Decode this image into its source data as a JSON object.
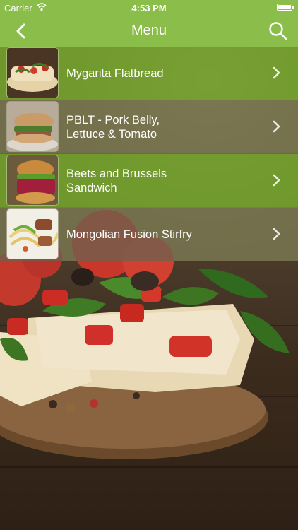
{
  "status_bar": {
    "carrier": "Carrier",
    "time": "4:53 PM"
  },
  "nav": {
    "title": "Menu",
    "back_icon": "chevron-left-icon",
    "search_icon": "search-icon"
  },
  "menu_items": [
    {
      "label": "Mygarita Flatbread",
      "thumbnail": "flatbread-photo"
    },
    {
      "label": "PBLT - Pork Belly,\nLettuce & Tomato",
      "thumbnail": "pblt-photo"
    },
    {
      "label": "Beets and Brussels\nSandwich",
      "thumbnail": "beet-sandwich-photo"
    },
    {
      "label": "Mongolian Fusion Stirfry",
      "thumbnail": "stirfry-photo"
    }
  ],
  "colors": {
    "bar_green": "#8bbd4a",
    "row_green": "#6c9628",
    "row_brown": "#70604e",
    "text": "#ffffff"
  }
}
